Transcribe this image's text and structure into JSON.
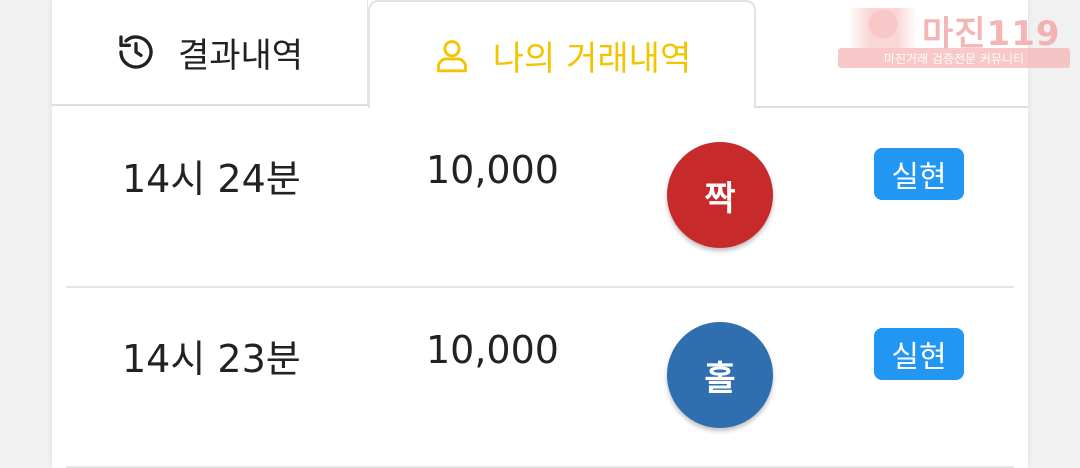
{
  "tabs": {
    "results_label": "결과내역",
    "results_icon": "history-icon",
    "mine_label": "나의 거래내역",
    "mine_icon": "user-icon"
  },
  "rows": [
    {
      "time": "14시 24분",
      "amount": "10,000",
      "pick": "짝",
      "pick_color": "#c62a2a",
      "status": "실현"
    },
    {
      "time": "14시 23분",
      "amount": "10,000",
      "pick": "홀",
      "pick_color": "#2f6fb0",
      "status": "실현"
    }
  ],
  "watermark": {
    "brand": "마진119",
    "tagline": "마진거래 검증전문 커뮤니티"
  },
  "colors": {
    "active_tab": "#f2c500",
    "badge": "#2196f3",
    "even_chip": "#c62a2a",
    "odd_chip": "#2f6fb0"
  }
}
